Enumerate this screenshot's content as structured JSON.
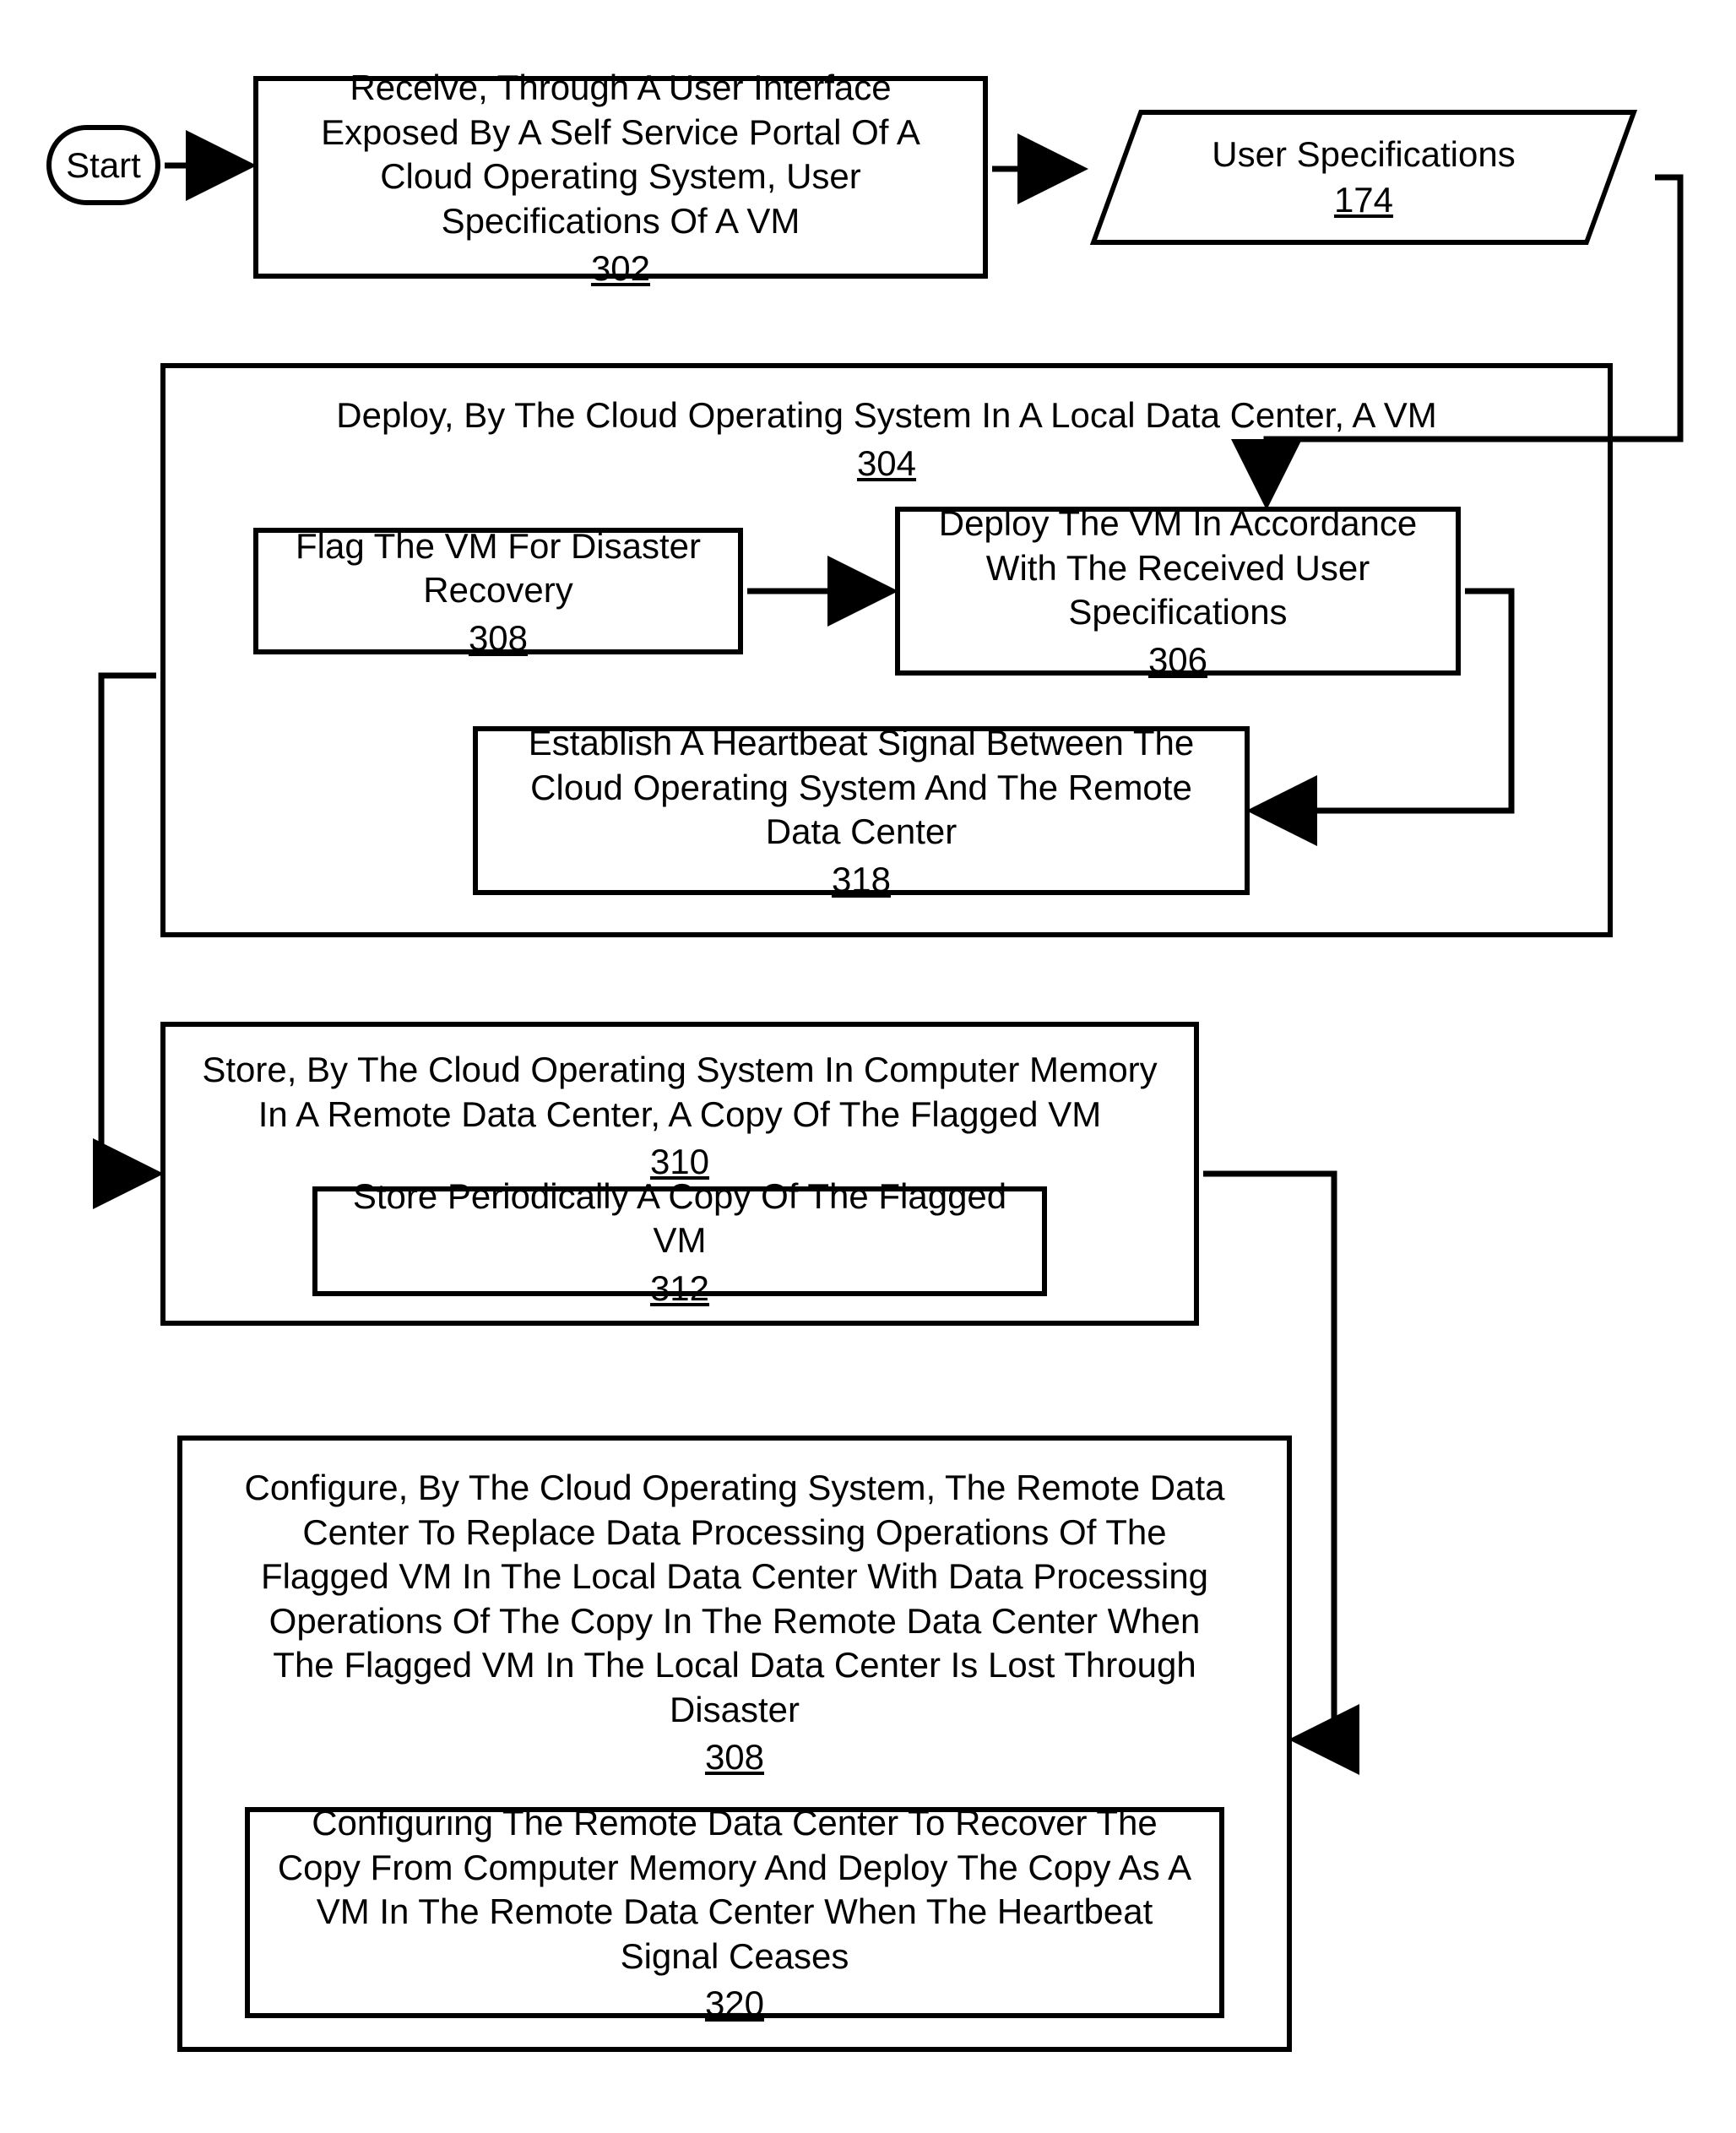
{
  "start": {
    "label": "Start"
  },
  "blocks": {
    "b302": {
      "text": "Receive, Through A User Interface Exposed By A Self Service Portal Of A Cloud Operating System, User Specifications Of A VM",
      "ref": "302"
    },
    "b174": {
      "text": "User Specifications",
      "ref": "174"
    },
    "b304": {
      "text": "Deploy, By The Cloud Operating System In A Local Data Center, A VM",
      "ref": "304"
    },
    "b308a": {
      "text": "Flag The VM For Disaster Recovery",
      "ref": "308"
    },
    "b306": {
      "text": "Deploy The VM In Accordance With The Received User Specifications",
      "ref": "306"
    },
    "b318": {
      "text": "Establish A Heartbeat Signal Between The Cloud Operating System And The Remote Data Center",
      "ref": "318"
    },
    "b310": {
      "text": "Store, By The Cloud Operating System In Computer Memory In A Remote Data Center, A Copy Of The Flagged VM",
      "ref": "310"
    },
    "b312": {
      "text": "Store Periodically A Copy Of The Flagged VM",
      "ref": "312"
    },
    "b308b": {
      "text": "Configure, By The Cloud Operating System, The Remote Data Center To Replace Data Processing Operations Of The Flagged VM In The Local Data Center With Data Processing Operations Of The Copy In The Remote Data Center When The Flagged VM In The Local Data Center Is Lost Through Disaster",
      "ref": "308"
    },
    "b320": {
      "text": "Configuring The Remote Data Center To Recover The Copy From Computer Memory And Deploy The Copy As A VM In The Remote Data Center When The Heartbeat Signal Ceases",
      "ref": "320"
    }
  }
}
